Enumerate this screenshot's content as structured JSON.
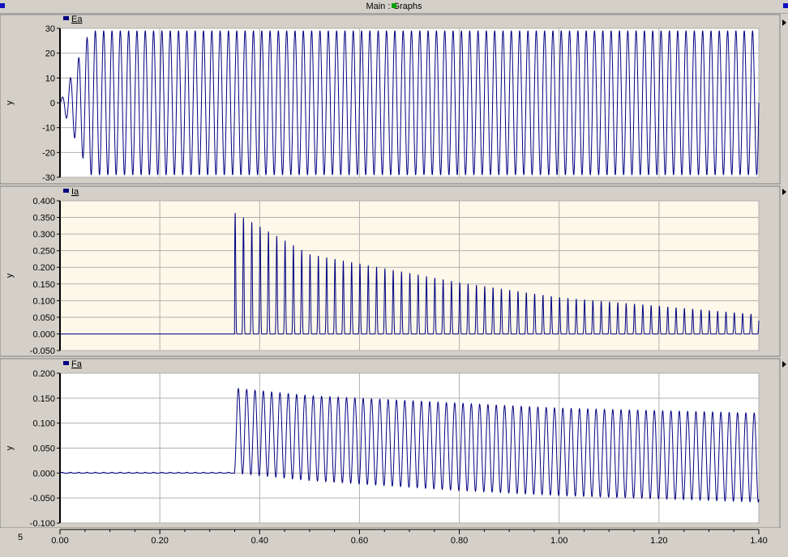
{
  "window": {
    "title": "Main : Graphs"
  },
  "colors": {
    "trace": "#000080",
    "background_white": "#ffffff",
    "background_cream": "#fdf8e9",
    "grid": "#b0b0b0",
    "frame": "#d4d0c8"
  },
  "icons": [
    "legend-swatch-icon",
    "scroll-arrow-icon"
  ],
  "corner_label": "5",
  "chart_data": [
    {
      "type": "line",
      "legend": "Ea",
      "ylabel": "y",
      "ylim": [
        -30,
        30
      ],
      "yticks": [
        "30",
        "20",
        "10",
        "0",
        "-10",
        "-20",
        "-30"
      ],
      "grid": true,
      "background": "white",
      "series": [
        {
          "name": "Ea",
          "description": "sinusoid, 60 Hz, amplitude ramps from 0 to 29 during t = 0.00-0.06 s then constant at 29",
          "frequency_hz": 60,
          "amplitude": 29,
          "ramp_end_s": 0.06
        }
      ]
    },
    {
      "type": "line",
      "legend": "Ia",
      "ylabel": "y",
      "ylim": [
        -0.05,
        0.4
      ],
      "yticks": [
        "0.400",
        "0.350",
        "0.300",
        "0.250",
        "0.200",
        "0.150",
        "0.100",
        "0.050",
        "0.000",
        "-0.050"
      ],
      "grid": true,
      "background": "cream",
      "series": [
        {
          "name": "Ia",
          "description": "zero until t = 0.35 s, then narrow positive current pulses once per cycle (60 Hz) decaying from about 0.365 to about 0.058 at t = 1.40 s",
          "start_s": 0.35,
          "frequency_hz": 60,
          "peaks": [
            [
              0.35,
              0.365
            ],
            [
              0.5,
              0.24
            ],
            [
              0.8,
              0.155
            ],
            [
              1.0,
              0.11
            ],
            [
              1.4,
              0.058
            ]
          ]
        }
      ]
    },
    {
      "type": "line",
      "legend": "Fa",
      "ylabel": "y",
      "ylim": [
        -0.1,
        0.2
      ],
      "yticks": [
        "0.200",
        "0.150",
        "0.100",
        "0.050",
        "0.000",
        "-0.050",
        "-0.100"
      ],
      "grid": true,
      "background": "white",
      "series": [
        {
          "name": "Fa",
          "description": "near zero until t = 0.35 s, then 60 Hz oscillation; maxima decay from about 0.17 to 0.12, minima drift from 0.0 to about -0.058",
          "start_s": 0.35,
          "frequency_hz": 60,
          "max_envelope": [
            [
              0.35,
              0.17
            ],
            [
              0.5,
              0.155
            ],
            [
              0.8,
              0.14
            ],
            [
              1.0,
              0.13
            ],
            [
              1.4,
              0.12
            ]
          ],
          "min_envelope": [
            [
              0.35,
              0.0
            ],
            [
              0.5,
              -0.015
            ],
            [
              0.8,
              -0.035
            ],
            [
              1.0,
              -0.045
            ],
            [
              1.4,
              -0.058
            ]
          ]
        }
      ]
    }
  ],
  "x_axis": {
    "xlim": [
      0,
      1.4
    ],
    "ticks": [
      "0.00",
      "0.20",
      "0.40",
      "0.60",
      "0.80",
      "1.00",
      "1.20",
      "1.40"
    ],
    "tick_values": [
      0,
      0.2,
      0.4,
      0.6,
      0.8,
      1.0,
      1.2,
      1.4
    ]
  }
}
